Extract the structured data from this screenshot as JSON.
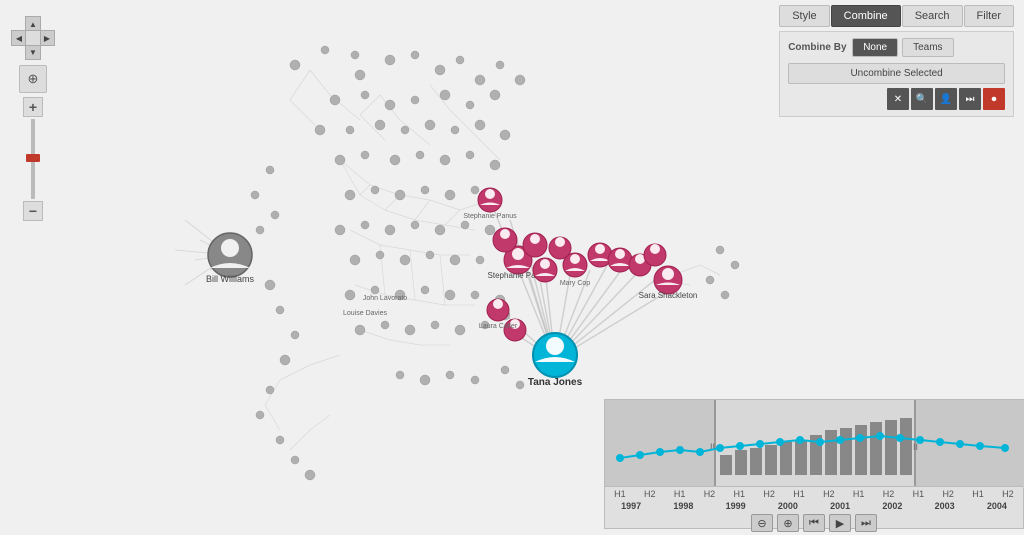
{
  "toolbar": {
    "tabs": [
      {
        "label": "Style",
        "active": false
      },
      {
        "label": "Combine",
        "active": true
      },
      {
        "label": "Search",
        "active": false
      },
      {
        "label": "Filter",
        "active": false
      }
    ],
    "combine_panel": {
      "combine_by_label": "Combine By",
      "options": [
        {
          "label": "None",
          "active": true
        },
        {
          "label": "Teams",
          "active": false
        }
      ],
      "uncombine_label": "Uncombine Selected"
    },
    "icon_buttons": [
      "✕",
      "🔍",
      "👤",
      "⏭",
      "⭕"
    ]
  },
  "timeline": {
    "period_labels": [
      "H1",
      "H2",
      "H1",
      "H2",
      "H1",
      "H2",
      "H1",
      "H2",
      "H1",
      "H2",
      "H1",
      "H2",
      "H1",
      "H2"
    ],
    "years": [
      "1997",
      "1998",
      "1999",
      "2000",
      "2001",
      "2002",
      "2003",
      "2004"
    ],
    "nav_buttons": [
      "⊖",
      "⊕",
      "⏮",
      "▶",
      "⏭"
    ]
  },
  "nodes": {
    "highlighted": "Tana Jones",
    "secondary_highlighted": [
      "Sara Shackleton",
      "Stephanie Panus"
    ],
    "large_node": "Bill Williams"
  }
}
